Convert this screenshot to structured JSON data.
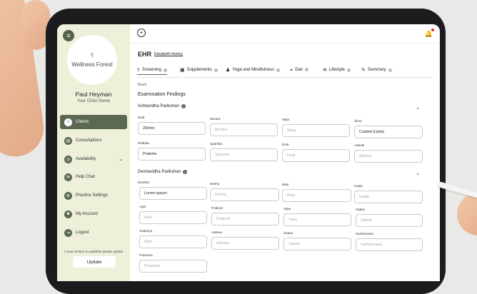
{
  "sidebar": {
    "logo_mark": "⚕",
    "logo_text": "Wellness Forest",
    "user_name": "Paul Heyman",
    "clinic_name": "Your Clinic Name",
    "nav": [
      {
        "label": "Clients",
        "icon": "clients-icon",
        "glyph": "☺"
      },
      {
        "label": "Consultations",
        "icon": "consultations-icon",
        "glyph": "▤"
      },
      {
        "label": "Availability",
        "icon": "availability-icon",
        "glyph": "◷"
      },
      {
        "label": "Help Chat",
        "icon": "chat-icon",
        "glyph": "✉"
      },
      {
        "label": "Practice Settings",
        "icon": "settings-icon",
        "glyph": "⚙"
      },
      {
        "label": "My Account",
        "icon": "account-icon",
        "glyph": "☻"
      },
      {
        "label": "Logout",
        "icon": "logout-icon",
        "glyph": "⇥"
      }
    ],
    "availability_chevron": "⌄",
    "update_note": "A new version is available please update",
    "update_label": "Update"
  },
  "header": {
    "add_glyph": "+",
    "bell_glyph": "🔔",
    "ehr_label": "EHR",
    "patient_name": "Elizabeth Hurley"
  },
  "tabs": [
    {
      "label": "Screening",
      "glyph": "⚕"
    },
    {
      "label": "Supplements",
      "glyph": "▣"
    },
    {
      "label": "Yoga and Mindfulness",
      "glyph": "♟"
    },
    {
      "label": "Diet",
      "glyph": "◒"
    },
    {
      "label": "Lifestyle",
      "glyph": "≋"
    },
    {
      "label": "Summary",
      "glyph": "✎"
    }
  ],
  "back_label": "Back",
  "exam_title": "Examination Findings",
  "ashta": {
    "title": "Ashtavidha Parikshan",
    "check": "✓",
    "chevron": "⌃",
    "fields": [
      {
        "label": "Nadi",
        "value": "20/min",
        "filled": true
      },
      {
        "label": "Mootra",
        "value": "Mootra",
        "filled": false
      },
      {
        "label": "Mala",
        "value": "Mala",
        "filled": false
      },
      {
        "label": "Jihva",
        "value": "Coated (Lipta)",
        "filled": true
      },
      {
        "label": "Shabda",
        "value": "Prakrita",
        "filled": true
      },
      {
        "label": "Sparsha",
        "value": "Sparsha",
        "filled": false
      },
      {
        "label": "Druk",
        "value": "Druk",
        "filled": false
      },
      {
        "label": "Aakruti",
        "value": "Aakruti",
        "filled": false
      }
    ]
  },
  "dasha": {
    "title": "Deshavidha Parikshan",
    "check": "✓",
    "chevron": "⌃",
    "fields": [
      {
        "label": "Doosha",
        "value": "Lorem ipsum",
        "filled": true
      },
      {
        "label": "Desha",
        "value": "Desha",
        "filled": false
      },
      {
        "label": "Bala",
        "value": "Bala",
        "filled": false
      },
      {
        "label": "Kaala",
        "value": "Kaala",
        "filled": false
      },
      {
        "label": "Agni",
        "value": "Agni",
        "filled": false
      },
      {
        "label": "Prakruti",
        "value": "Prakruti",
        "filled": false
      },
      {
        "label": "Vaya",
        "value": "Vaya",
        "filled": false
      },
      {
        "label": "Sattva",
        "value": "Sattva",
        "filled": false
      },
      {
        "label": "Saatmya",
        "value": "Agni",
        "filled": false
      },
      {
        "label": "Aahara",
        "value": "Aahara",
        "filled": false
      },
      {
        "label": "Saasa",
        "value": "Saasa",
        "filled": false
      },
      {
        "label": "Samhanana",
        "value": "Samhanana",
        "filled": false
      },
      {
        "label": "Pramana",
        "value": "Pramana",
        "filled": false
      }
    ]
  }
}
